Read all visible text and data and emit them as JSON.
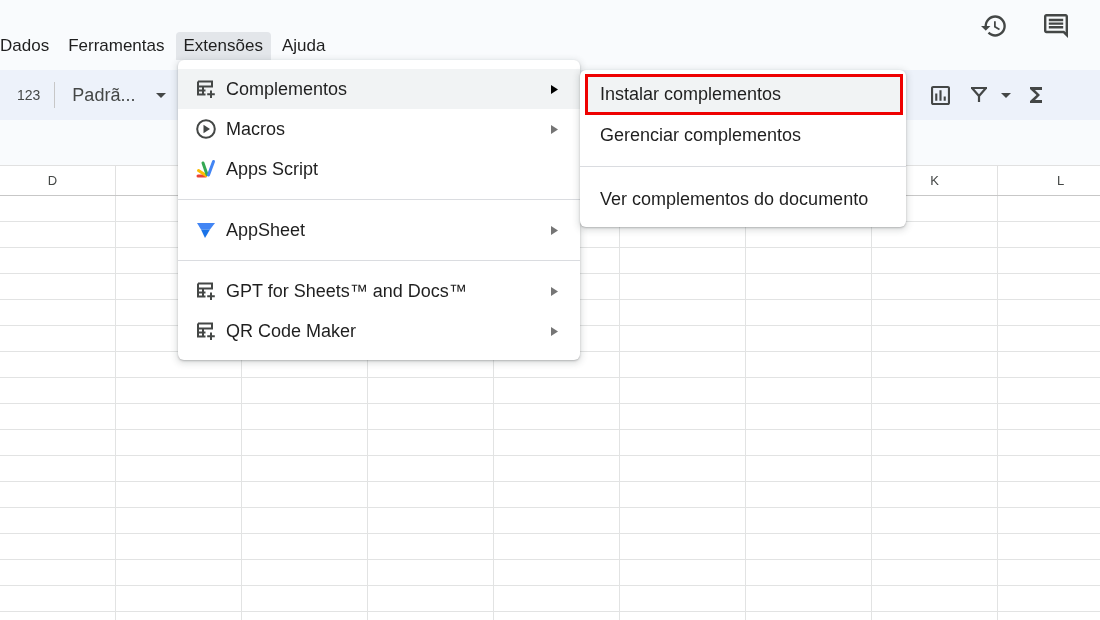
{
  "menu_bar": {
    "items": [
      {
        "label": "Dados",
        "selected": false
      },
      {
        "label": "Ferramentas",
        "selected": false
      },
      {
        "label": "Extensões",
        "selected": true
      },
      {
        "label": "Ajuda",
        "selected": false
      }
    ]
  },
  "toolbar": {
    "number_format": "123",
    "font": "Padrã..."
  },
  "grid": {
    "columns": [
      {
        "label": "D"
      },
      {
        "label": "K"
      },
      {
        "label": "L"
      }
    ]
  },
  "extensions_menu": {
    "groups": [
      [
        {
          "kind": "addon",
          "label": "Complementos",
          "has_submenu": true,
          "expanded": true
        },
        {
          "kind": "macros",
          "label": "Macros",
          "has_submenu": true,
          "expanded": false
        },
        {
          "kind": "script",
          "label": "Apps Script",
          "has_submenu": false,
          "expanded": false
        }
      ],
      [
        {
          "kind": "appsheet",
          "label": "AppSheet",
          "has_submenu": true,
          "expanded": false
        }
      ],
      [
        {
          "kind": "addon",
          "label": "GPT for Sheets™ and Docs™",
          "has_submenu": true,
          "expanded": false
        },
        {
          "kind": "addon",
          "label": "QR Code Maker",
          "has_submenu": true,
          "expanded": false
        }
      ]
    ]
  },
  "submenu": {
    "groups": [
      [
        {
          "label": "Instalar complementos",
          "selected": true,
          "outlined": true
        },
        {
          "label": "Gerenciar complementos",
          "selected": false,
          "outlined": false
        }
      ],
      [
        {
          "label": "Ver complementos do documento",
          "selected": false,
          "outlined": false
        }
      ]
    ]
  }
}
